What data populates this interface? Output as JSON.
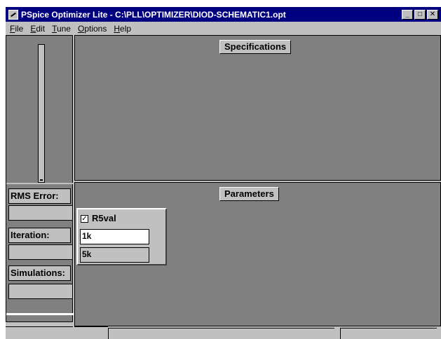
{
  "window": {
    "title": "PSpice Optimizer Lite - C:\\PLL\\OPTIMIZER\\DIOD-SCHEMATIC1.opt",
    "minimize_glyph": "_",
    "maximize_glyph": "□",
    "close_glyph": "✕"
  },
  "menu": {
    "file": {
      "underline": "F",
      "rest": "ile"
    },
    "edit": {
      "underline": "E",
      "rest": "dit"
    },
    "tune": {
      "underline": "T",
      "rest": "une"
    },
    "options": {
      "underline": "O",
      "rest": "ptions"
    },
    "help": {
      "underline": "H",
      "rest": "elp"
    }
  },
  "left_panel": {
    "rms_error_label": "RMS Error:",
    "rms_error_value": "",
    "iteration_label": "Iteration:",
    "iteration_value": "",
    "simulations_label": "Simulations:",
    "simulations_value": ""
  },
  "specifications": {
    "header": "Specifications"
  },
  "parameters": {
    "header": "Parameters",
    "items": [
      {
        "checked_glyph": "✓",
        "name": "R5val",
        "value": "1k",
        "initial": "5k"
      }
    ]
  },
  "colors": {
    "titlebar": "#000080",
    "panel_dark": "#808080",
    "face": "#c0c0c0"
  }
}
